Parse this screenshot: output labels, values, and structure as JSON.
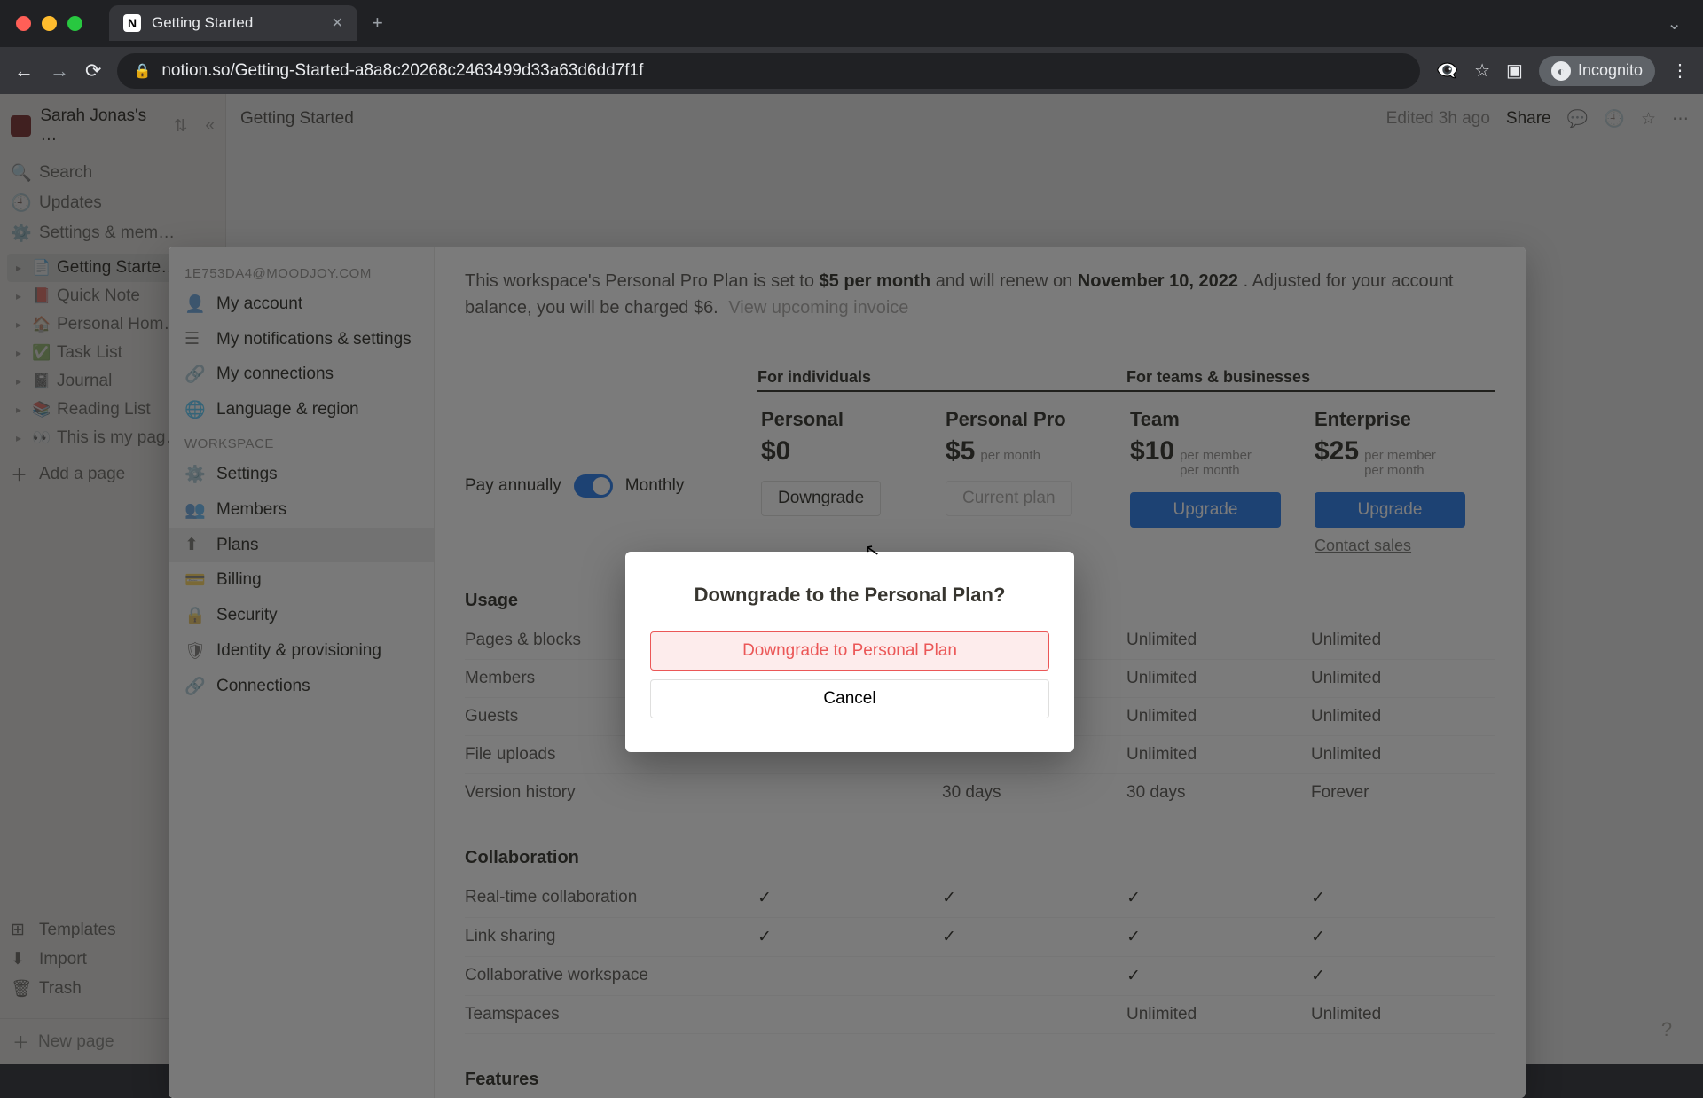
{
  "browser": {
    "tab_title": "Getting Started",
    "url": "notion.so/Getting-Started-a8a8c20268c2463499d33a63d6dd7f1f",
    "incognito_label": "Incognito"
  },
  "notion_sidebar": {
    "workspace_name": "Sarah Jonas's …",
    "search": "Search",
    "updates": "Updates",
    "settings": "Settings & mem…",
    "pages": [
      {
        "emoji": "📄",
        "label": "Getting Starte…",
        "active": true
      },
      {
        "emoji": "📕",
        "label": "Quick Note"
      },
      {
        "emoji": "🏠",
        "label": "Personal Hom…"
      },
      {
        "emoji": "✅",
        "label": "Task List"
      },
      {
        "emoji": "📓",
        "label": "Journal"
      },
      {
        "emoji": "📚",
        "label": "Reading List"
      },
      {
        "emoji": "👀",
        "label": "This is my pag…"
      }
    ],
    "add_page": "Add a page",
    "templates": "Templates",
    "import": "Import",
    "trash": "Trash",
    "new_page": "New page"
  },
  "topbar": {
    "breadcrumb": "Getting Started",
    "edited": "Edited 3h ago",
    "share": "Share"
  },
  "settings": {
    "email": "1E753DA4@MOODJOY.COM",
    "sections": {
      "account_label": "",
      "workspace_label": "WORKSPACE"
    },
    "account_items": [
      "My account",
      "My notifications & settings",
      "My connections",
      "Language & region"
    ],
    "workspace_items": [
      "Settings",
      "Members",
      "Plans",
      "Billing",
      "Security",
      "Identity & provisioning",
      "Connections"
    ],
    "billing_notice": {
      "prefix": "This workspace's Personal Pro Plan is set to ",
      "price": "$5 per month",
      "mid": " and will renew on ",
      "date": "November 10, 2022",
      "suffix": ". Adjusted for your account balance, you will be charged $6.",
      "link": "View upcoming invoice"
    },
    "pay_toggle": {
      "annually": "Pay annually",
      "monthly": "Monthly"
    },
    "group_labels": {
      "individuals": "For individuals",
      "teams": "For teams & businesses"
    },
    "plans": [
      {
        "name": "Personal",
        "price": "$0",
        "sub1": "",
        "sub2": "",
        "action": "Downgrade",
        "style": "default"
      },
      {
        "name": "Personal Pro",
        "price": "$5",
        "sub1": "per month",
        "sub2": "",
        "action": "Current plan",
        "style": "muted"
      },
      {
        "name": "Team",
        "price": "$10",
        "sub1": "per member",
        "sub2": "per month",
        "action": "Upgrade",
        "style": "primary"
      },
      {
        "name": "Enterprise",
        "price": "$25",
        "sub1": "per member",
        "sub2": "per month",
        "action": "Upgrade",
        "style": "primary",
        "contact": "Contact sales"
      }
    ],
    "usage": {
      "title": "Usage",
      "rows": [
        {
          "label": "Pages & blocks",
          "cells": [
            "",
            "",
            "Unlimited",
            "Unlimited"
          ]
        },
        {
          "label": "Members",
          "cells": [
            "",
            "",
            "Unlimited",
            "Unlimited"
          ]
        },
        {
          "label": "Guests",
          "cells": [
            "",
            "",
            "Unlimited",
            "Unlimited"
          ]
        },
        {
          "label": "File uploads",
          "cells": [
            "",
            "",
            "Unlimited",
            "Unlimited"
          ]
        },
        {
          "label": "Version history",
          "cells": [
            "",
            "30 days",
            "30 days",
            "Forever"
          ]
        }
      ]
    },
    "collab": {
      "title": "Collaboration",
      "rows": [
        {
          "label": "Real-time collaboration",
          "cells": [
            "✓",
            "✓",
            "✓",
            "✓"
          ]
        },
        {
          "label": "Link sharing",
          "cells": [
            "✓",
            "✓",
            "✓",
            "✓"
          ]
        },
        {
          "label": "Collaborative workspace",
          "cells": [
            "",
            "",
            "✓",
            "✓"
          ]
        },
        {
          "label": "Teamspaces",
          "cells": [
            "",
            "",
            "Unlimited",
            "Unlimited"
          ]
        }
      ]
    },
    "features": {
      "title": "Features"
    }
  },
  "dialog": {
    "title": "Downgrade to the Personal Plan?",
    "confirm": "Downgrade to Personal Plan",
    "cancel": "Cancel"
  }
}
